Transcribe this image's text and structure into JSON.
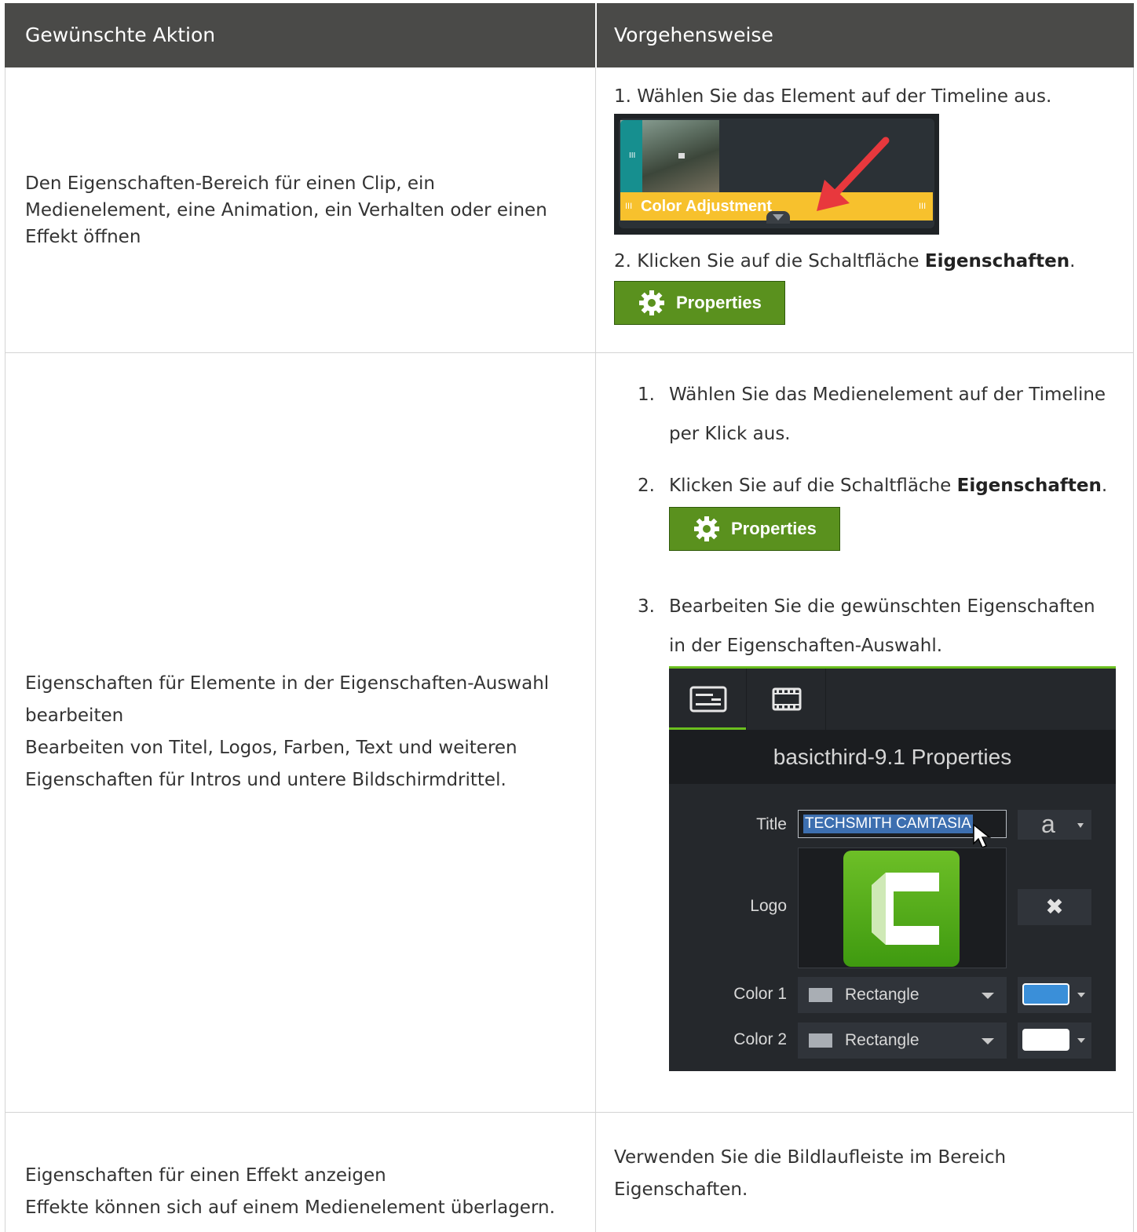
{
  "header": {
    "col1": "Gewünschte Aktion",
    "col2": "Vorgehensweise"
  },
  "rows": [
    {
      "action_lines": [
        "Den Eigenschaften-Bereich für einen Clip, ein",
        "Medienelement, eine Animation, ein Verhalten oder einen",
        "Effekt öffnen"
      ],
      "step1": "1. Wählen Sie das Element auf der Timeline aus.",
      "timeline_label": "Color Adjustment",
      "step2_prefix": "2. Klicken Sie auf die Schaltfläche ",
      "step2_bold": "Eigenschaften",
      "step2_suffix": ".",
      "button_label": "Properties"
    },
    {
      "action_lines": [
        "Eigenschaften für Elemente in der Eigenschaften-Auswahl",
        "bearbeiten",
        "Bearbeiten von Titel, Logos, Farben, Text und weiteren",
        "Eigenschaften für Intros und untere Bildschirmdrittel."
      ],
      "steps": [
        {
          "num": "1.",
          "lines": [
            "Wählen Sie das Medienelement auf der Timeline",
            "per Klick aus."
          ]
        },
        {
          "num": "2.",
          "prefix": "Klicken Sie auf die Schaltfläche ",
          "bold": "Eigenschaften",
          "suffix": "."
        },
        {
          "num": "3.",
          "lines": [
            "Bearbeiten Sie die gewünschten Eigenschaften",
            "in der Eigenschaften-Auswahl."
          ]
        }
      ],
      "button_label": "Properties",
      "panel": {
        "title": "basicthird-9.1 Properties",
        "title_label": "Title",
        "title_value": "TECHSMITH CAMTASIA",
        "font_glyph": "a",
        "logo_label": "Logo",
        "remove_glyph": "✖",
        "color1_label": "Color 1",
        "color2_label": "Color 2",
        "shape1": "Rectangle",
        "shape2": "Rectangle",
        "color1_hex": "#3a8fd9",
        "color2_hex": "#ffffff"
      }
    },
    {
      "action_lines": [
        "Eigenschaften für einen Effekt anzeigen",
        "Effekte können sich auf einem Medienelement überlagern."
      ],
      "how_lines": [
        "Verwenden Sie die Bildlaufleiste im Bereich",
        "Eigenschaften."
      ]
    }
  ],
  "colors": {
    "header_bg": "#4a4a48",
    "accent_green": "#5a911e",
    "timeline_yellow": "#f7c12d",
    "arrow_red": "#e8383d"
  }
}
